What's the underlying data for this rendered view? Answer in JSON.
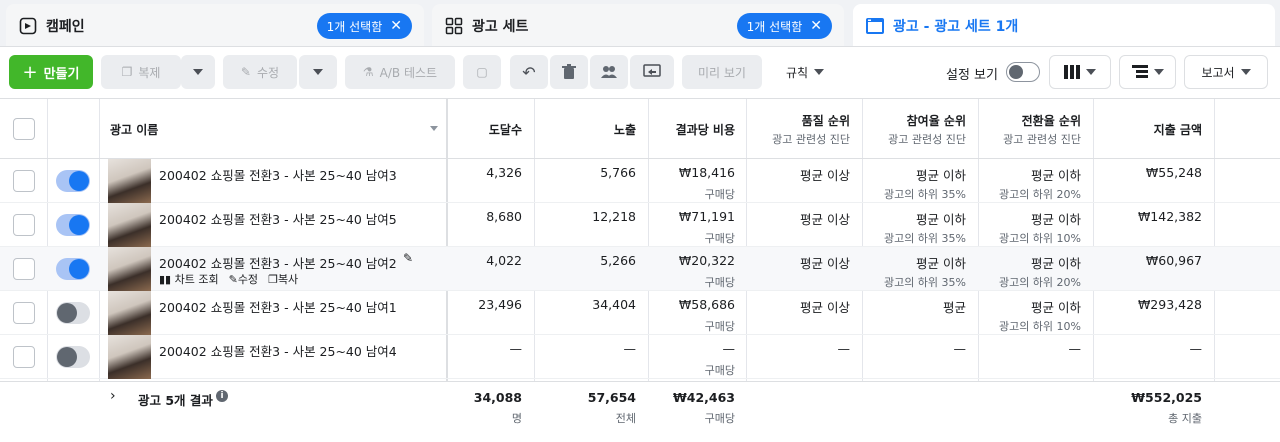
{
  "tabs": [
    {
      "label": "캠페인",
      "badge": "1개 선택함"
    },
    {
      "label": "광고 세트",
      "badge": "1개 선택함"
    },
    {
      "label": "광고 - 광고 세트 1개"
    }
  ],
  "toolbar": {
    "create": "만들기",
    "duplicate": "복제",
    "edit": "수정",
    "ab_test": "A/B 테스트",
    "preview": "미리 보기",
    "rules": "규칙",
    "view_setup": "설정 보기",
    "reports": "보고서"
  },
  "columns": {
    "ad_name": "광고 이름",
    "reach": "도달수",
    "impressions": "노출",
    "cost_per_result": "결과당 비용",
    "quality": {
      "title": "품질 순위",
      "sub": "광고 관련성 진단"
    },
    "engagement": {
      "title": "참여율 순위",
      "sub": "광고 관련성 진단"
    },
    "conversion": {
      "title": "전환율 순위",
      "sub": "광고 관련성 진단"
    },
    "spend": "지출 금액"
  },
  "rows": [
    {
      "name": "200402 쇼핑몰 전환3 - 사본 25~40 남여3",
      "on": true,
      "reach": "4,326",
      "impressions": "5,766",
      "cpr": "₩18,416",
      "cpr_sub": "구매당",
      "quality": "평균 이상",
      "engagement": "평균 이하",
      "engagement_sub": "광고의 하위 35%",
      "conversion": "평균 이하",
      "conversion_sub": "광고의 하위 20%",
      "spend": "₩55,248"
    },
    {
      "name": "200402 쇼핑몰 전환3 - 사본 25~40 남여5",
      "on": true,
      "reach": "8,680",
      "impressions": "12,218",
      "cpr": "₩71,191",
      "cpr_sub": "구매당",
      "quality": "평균 이상",
      "engagement": "평균 이하",
      "engagement_sub": "광고의 하위 35%",
      "conversion": "평균 이하",
      "conversion_sub": "광고의 하위 10%",
      "spend": "₩142,382"
    },
    {
      "name": "200402 쇼핑몰 전환3 - 사본 25~40 남여2",
      "on": true,
      "reach": "4,022",
      "impressions": "5,266",
      "cpr": "₩20,322",
      "cpr_sub": "구매당",
      "quality": "평균 이상",
      "engagement": "평균 이하",
      "engagement_sub": "광고의 하위 35%",
      "conversion": "평균 이하",
      "conversion_sub": "광고의 하위 20%",
      "spend": "₩60,967",
      "actions": {
        "chart": "차트 조회",
        "edit": "수정",
        "copy": "복사"
      }
    },
    {
      "name": "200402 쇼핑몰 전환3 - 사본 25~40 남여1",
      "on": false,
      "reach": "23,496",
      "impressions": "34,404",
      "cpr": "₩58,686",
      "cpr_sub": "구매당",
      "quality": "평균 이상",
      "engagement": "평균",
      "engagement_sub": "",
      "conversion": "평균 이하",
      "conversion_sub": "광고의 하위 10%",
      "spend": "₩293,428"
    },
    {
      "name": "200402 쇼핑몰 전환3 - 사본 25~40 남여4",
      "on": false,
      "reach": "—",
      "impressions": "—",
      "cpr": "—",
      "cpr_sub": "구매당",
      "quality": "—",
      "engagement": "—",
      "engagement_sub": "",
      "conversion": "—",
      "conversion_sub": "",
      "spend": "—"
    }
  ],
  "footer": {
    "label": "광고 5개 결과",
    "reach": "34,088",
    "reach_sub": "명",
    "impressions": "57,654",
    "impressions_sub": "전체",
    "cpr": "₩42,463",
    "cpr_sub": "구매당",
    "spend": "₩552,025",
    "spend_sub": "총 지출"
  }
}
